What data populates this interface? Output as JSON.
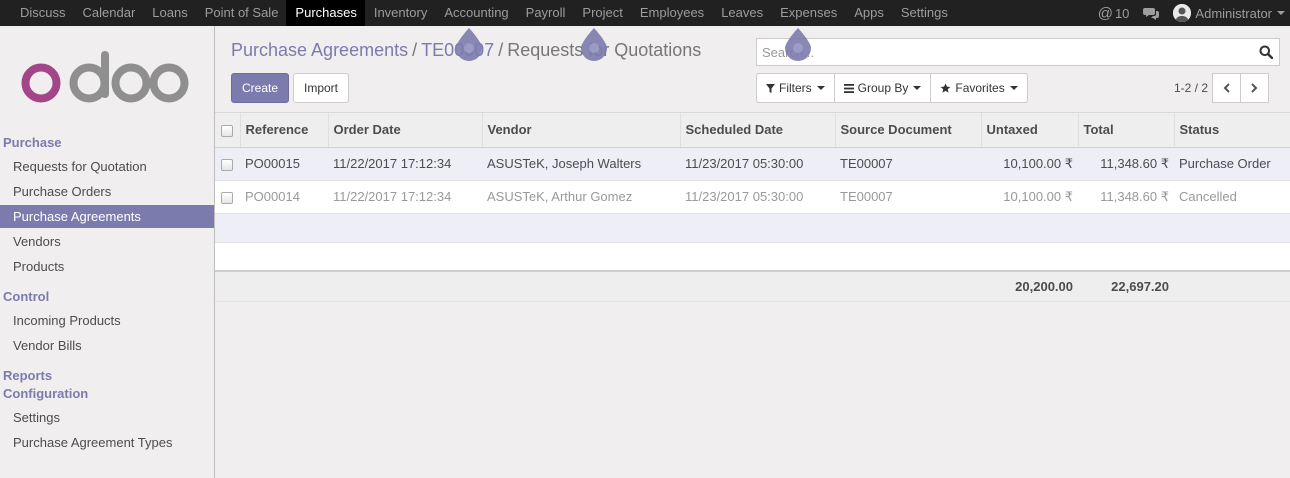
{
  "nav": {
    "menu": [
      "Discuss",
      "Calendar",
      "Loans",
      "Point of Sale",
      "Purchases",
      "Inventory",
      "Accounting",
      "Payroll",
      "Project",
      "Employees",
      "Leaves",
      "Expenses",
      "Apps",
      "Settings"
    ],
    "active": "Purchases",
    "notification_count": "10",
    "user_name": "Administrator"
  },
  "sidebar": {
    "sections": [
      {
        "title": "Purchase",
        "items": [
          "Requests for Quotation",
          "Purchase Orders",
          "Purchase Agreements",
          "Vendors",
          "Products"
        ]
      },
      {
        "title": "Control",
        "items": [
          "Incoming Products",
          "Vendor Bills"
        ]
      },
      {
        "title": "Reports",
        "items": []
      },
      {
        "title": "Configuration",
        "items": [
          "Settings",
          "Purchase Agreement Types"
        ]
      }
    ],
    "active_item": "Purchase Agreements"
  },
  "breadcrumb": {
    "items": [
      "Purchase Agreements",
      "TE00007",
      "Requests for Quotations"
    ],
    "separator": "/"
  },
  "buttons": {
    "create": "Create",
    "import": "Import"
  },
  "search": {
    "value": "Search..."
  },
  "filters": {
    "filters": "Filters",
    "group_by": "Group By",
    "favorites": "Favorites"
  },
  "pager": {
    "value": "1-2 / 2"
  },
  "table": {
    "columns": [
      "Reference",
      "Order Date",
      "Vendor",
      "Scheduled Date",
      "Source Document",
      "Untaxed",
      "Total",
      "Status"
    ],
    "rows": [
      {
        "reference": "PO00015",
        "order_date": "11/22/2017 17:12:34",
        "vendor": "ASUSTeK, Joseph Walters",
        "scheduled_date": "11/23/2017 05:30:00",
        "source": "TE00007",
        "untaxed": "10,100.00 ₹",
        "total": "11,348.60 ₹",
        "status": "Purchase Order"
      },
      {
        "reference": "PO00014",
        "order_date": "11/22/2017 17:12:34",
        "vendor": "ASUSTeK, Arthur Gomez",
        "scheduled_date": "11/23/2017 05:30:00",
        "source": "TE00007",
        "untaxed": "10,100.00 ₹",
        "total": "11,348.60 ₹",
        "status": "Cancelled"
      }
    ],
    "totals": {
      "untaxed": "20,200.00",
      "total": "22,697.20"
    }
  },
  "colors": {
    "brand": "#7c7bad",
    "topbar": "#212121",
    "logo_o": "#a24689",
    "logo_gray": "#8f8f8f"
  }
}
